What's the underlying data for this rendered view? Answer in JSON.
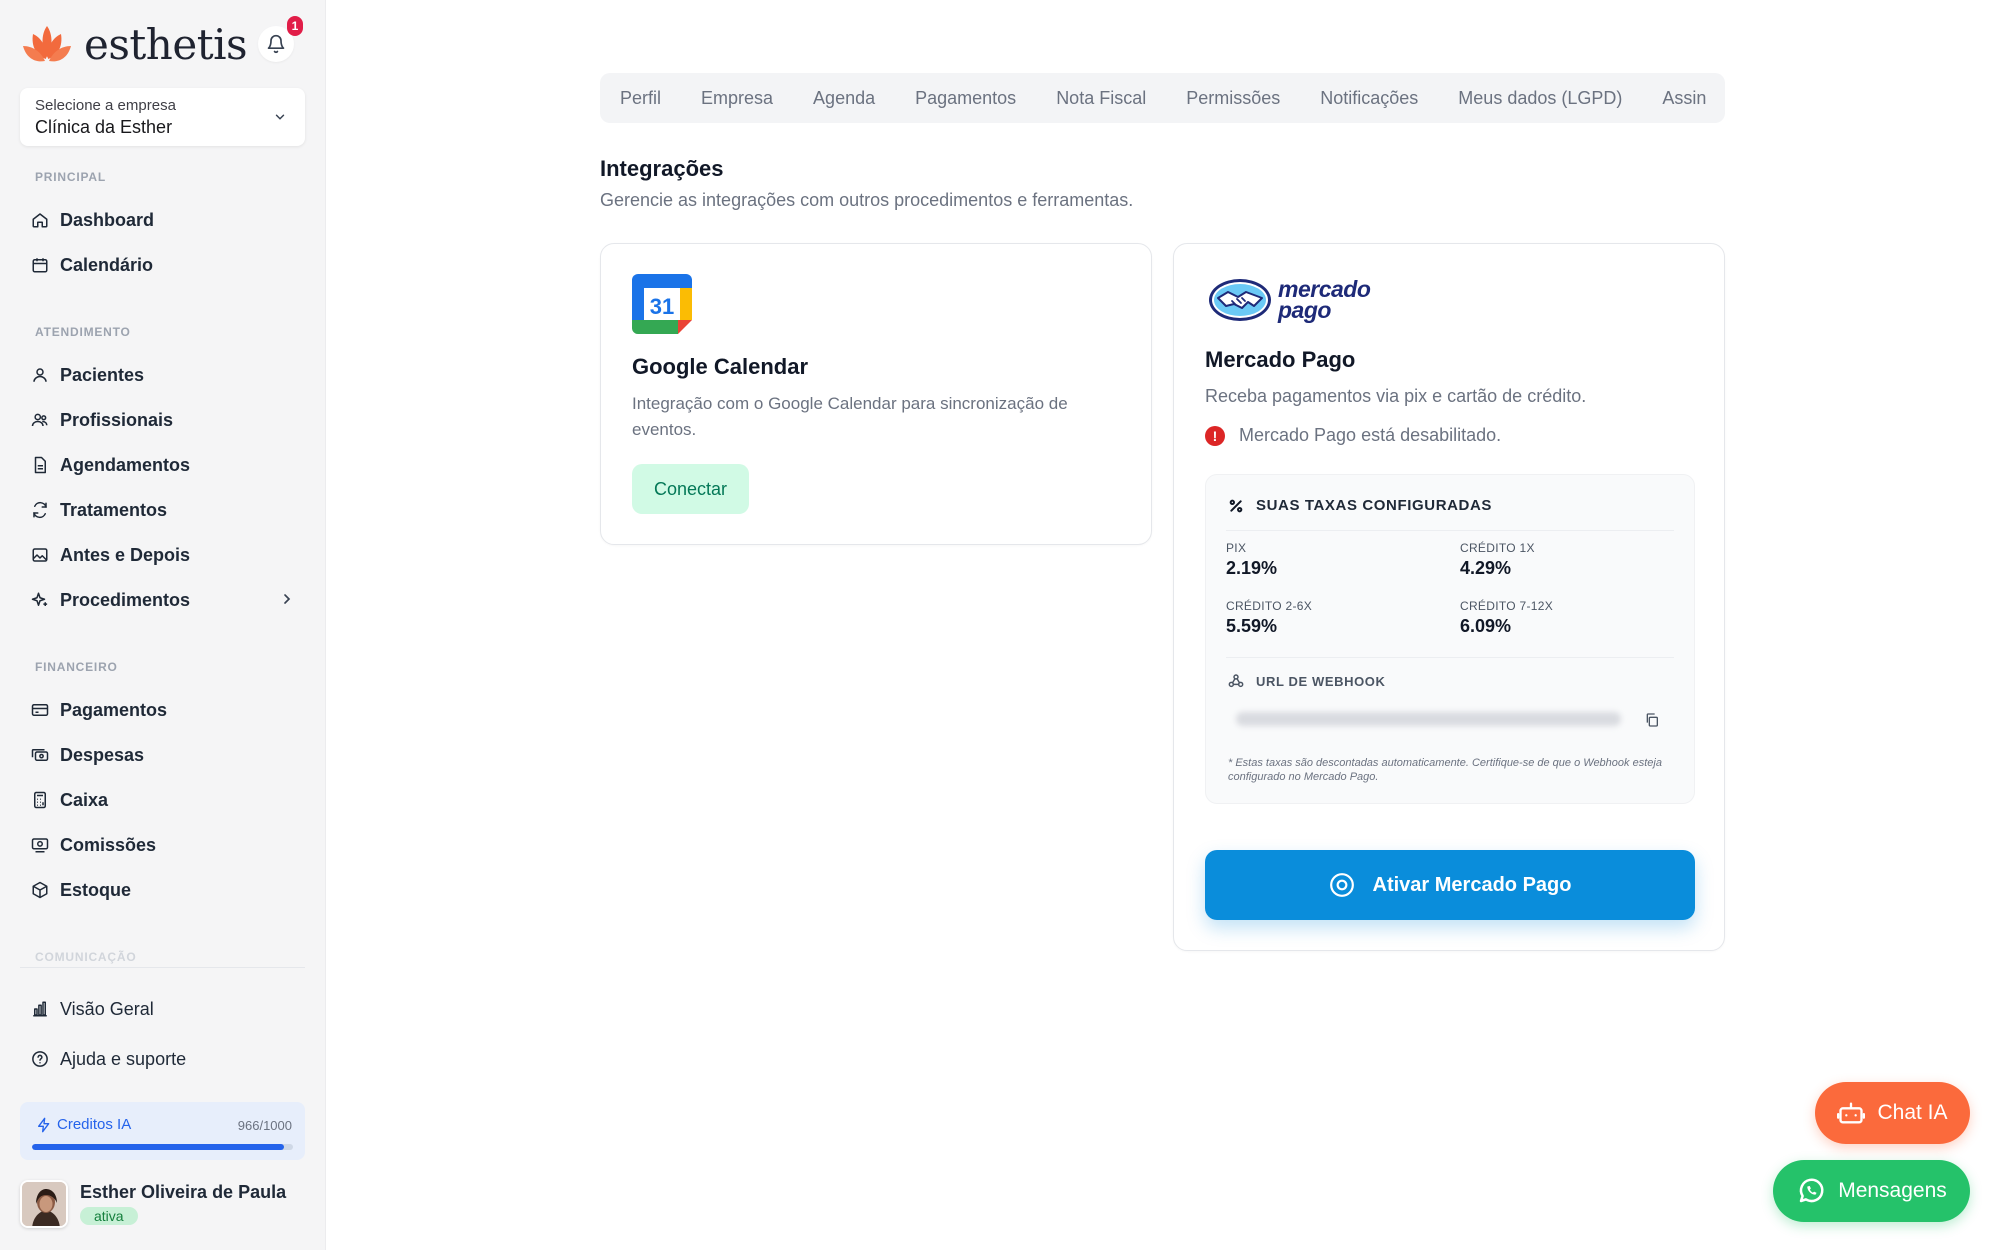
{
  "brand": {
    "name": "esthetis",
    "notification_count": "1"
  },
  "company_select": {
    "label": "Selecione a empresa",
    "value": "Clínica da Esther"
  },
  "sidebar": {
    "sections": [
      {
        "label": "PRINCIPAL",
        "items": [
          {
            "label": "Dashboard",
            "icon": "home-icon"
          },
          {
            "label": "Calendário",
            "icon": "calendar-icon"
          }
        ]
      },
      {
        "label": "ATENDIMENTO",
        "items": [
          {
            "label": "Pacientes",
            "icon": "user-icon"
          },
          {
            "label": "Profissionais",
            "icon": "users-icon"
          },
          {
            "label": "Agendamentos",
            "icon": "file-icon"
          },
          {
            "label": "Tratamentos",
            "icon": "refresh-icon"
          },
          {
            "label": "Antes e Depois",
            "icon": "image-icon"
          },
          {
            "label": "Procedimentos",
            "icon": "sparkles-icon"
          }
        ]
      },
      {
        "label": "FINANCEIRO",
        "items": [
          {
            "label": "Pagamentos",
            "icon": "credit-card-icon"
          },
          {
            "label": "Despesas",
            "icon": "money-icon"
          },
          {
            "label": "Caixa",
            "icon": "calculator-icon"
          },
          {
            "label": "Comissões",
            "icon": "commission-icon"
          },
          {
            "label": "Estoque",
            "icon": "box-icon"
          }
        ]
      },
      {
        "label": "COMUNICAÇÃO"
      }
    ],
    "bottom": [
      {
        "label": "Visão Geral",
        "icon": "bar-chart-icon"
      },
      {
        "label": "Ajuda e suporte",
        "icon": "help-icon"
      }
    ]
  },
  "credits": {
    "label": "Creditos IA",
    "count": "966/1000",
    "fraction": 0.966
  },
  "user": {
    "name": "Esther Oliveira de Paula",
    "status": "ativa"
  },
  "tabs": [
    "Perfil",
    "Empresa",
    "Agenda",
    "Pagamentos",
    "Nota Fiscal",
    "Permissões",
    "Notificações",
    "Meus dados (LGPD)",
    "Assin"
  ],
  "page": {
    "title": "Integrações",
    "subtitle": "Gerencie as integrações com outros procedimentos e ferramentas."
  },
  "google_calendar": {
    "icon_number": "31",
    "title": "Google Calendar",
    "description": "Integração com o Google Calendar para sincronização de eventos.",
    "button": "Conectar"
  },
  "mercado_pago": {
    "logo_line1": "mercado",
    "logo_line2": "pago",
    "title": "Mercado Pago",
    "description": "Receba pagamentos via pix e cartão de crédito.",
    "status": "Mercado Pago está desabilitado.",
    "fees_title": "SUAS TAXAS CONFIGURADAS",
    "fees": [
      {
        "label": "PIX",
        "value": "2.19%"
      },
      {
        "label": "CRÉDITO 1X",
        "value": "4.29%"
      },
      {
        "label": "CRÉDITO 2-6X",
        "value": "5.59%"
      },
      {
        "label": "CRÉDITO 7-12X",
        "value": "6.09%"
      }
    ],
    "webhook_title": "URL DE WEBHOOK",
    "note": "* Estas taxas são descontadas automaticamente. Certifique-se de que o Webhook esteja configurado no Mercado Pago.",
    "button": "Ativar Mercado Pago"
  },
  "floating": {
    "chat": "Chat IA",
    "messages": "Mensagens"
  },
  "colors": {
    "accent": "#0a8ddb",
    "brand": "#f26a3d",
    "success": "#25c26a",
    "danger": "#dc2626"
  }
}
